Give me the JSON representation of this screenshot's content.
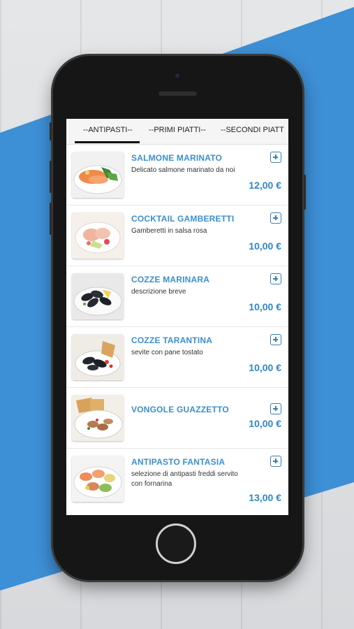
{
  "colors": {
    "accent_blue": "#3a8fcf",
    "background_band": "#3d8fd6",
    "phone_body": "#161616"
  },
  "tabs": [
    {
      "label": "--ANTIPASTI--",
      "selected": true
    },
    {
      "label": "--PRIMI PIATTI--",
      "selected": false
    },
    {
      "label": "--SECONDI PIATT",
      "selected": false
    }
  ],
  "menu_items": [
    {
      "name": "SALMONE MARINATO",
      "description": "Delicato salmone marinato da noi",
      "price": "12,00 €",
      "icon": "plus-square-icon"
    },
    {
      "name": "COCKTAIL GAMBERETTI",
      "description": "Gamberetti in salsa rosa",
      "price": "10,00 €",
      "icon": "plus-square-icon"
    },
    {
      "name": "COZZE MARINARA",
      "description": "descrizione breve",
      "price": "10,00 €",
      "icon": "plus-square-icon"
    },
    {
      "name": "COZZE TARANTINA",
      "description": "sevite con pane tostato",
      "price": "10,00 €",
      "icon": "plus-square-icon"
    },
    {
      "name": "VONGOLE GUAZZETTO",
      "description": "",
      "price": "10,00 €",
      "icon": "plus-square-icon"
    },
    {
      "name": "ANTIPASTO FANTASIA",
      "description": "selezione di antipasti freddi servito con fornarina",
      "price": "13,00 €",
      "icon": "plus-square-icon"
    }
  ]
}
